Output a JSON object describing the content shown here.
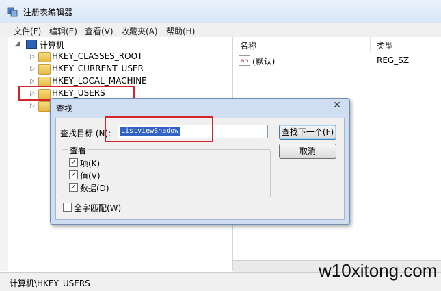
{
  "window": {
    "title": "注册表编辑器"
  },
  "menu": [
    "文件(F)",
    "编辑(E)",
    "查看(V)",
    "收藏夹(A)",
    "帮助(H)"
  ],
  "tree": {
    "root": "计算机",
    "nodes": [
      "HKEY_CLASSES_ROOT",
      "HKEY_CURRENT_USER",
      "HKEY_LOCAL_MACHINE",
      "HKEY_USERS"
    ]
  },
  "list": {
    "columns": [
      "名称",
      "类型"
    ],
    "rows": [
      {
        "name": "(默认)",
        "type": "REG_SZ"
      }
    ]
  },
  "status": "计算机\\HKEY_USERS",
  "dialog": {
    "title": "查找",
    "find_label": "查找目标 (N):",
    "find_value": "ListviewShadow",
    "find_next_button": "查找下一个(F)",
    "cancel_button": "取消",
    "look_at_group": "查看",
    "options": [
      {
        "label": "项(K)",
        "checked": true
      },
      {
        "label": "值(V)",
        "checked": true
      },
      {
        "label": "数据(D)",
        "checked": true
      }
    ],
    "match_whole": {
      "label": "全字匹配(W)",
      "checked": false
    }
  },
  "watermark": "w10xitong.com",
  "colors": {
    "highlight_box": "#d4242c",
    "selection": "#3163c5"
  }
}
